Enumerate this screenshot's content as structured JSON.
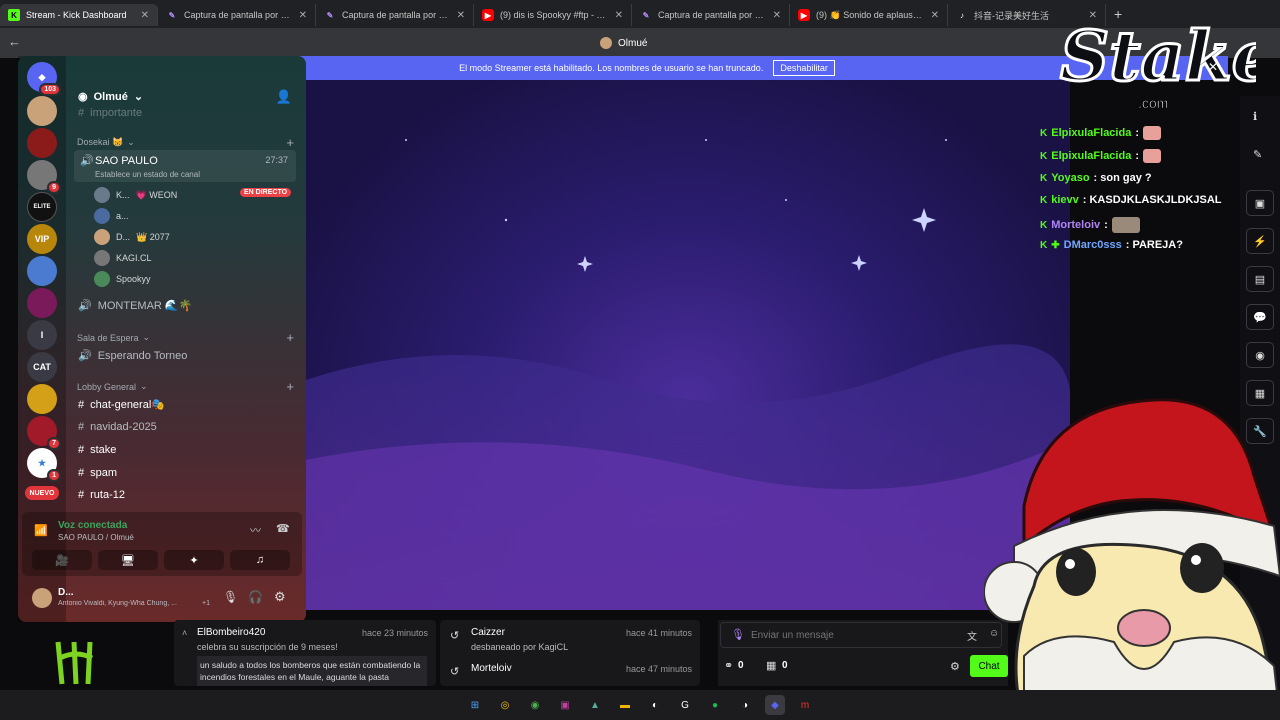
{
  "browser": {
    "tabs": [
      {
        "title": "Stream - Kick Dashboard",
        "icon": "kick-icon",
        "active": true
      },
      {
        "title": "Captura de pantalla por Lightsh",
        "icon": "lightshot-icon"
      },
      {
        "title": "Captura de pantalla por Lightsh",
        "icon": "lightshot-icon"
      },
      {
        "title": "(9) dis is Spookyy #ftp - YouTub",
        "icon": "youtube-icon"
      },
      {
        "title": "Captura de pantalla por Lightsh",
        "icon": "lightshot-icon"
      },
      {
        "title": "(9) 👏 Sonido de aplausos y gr",
        "icon": "youtube-icon"
      },
      {
        "title": "抖音-记录美好生活",
        "icon": "tiktok-icon"
      }
    ]
  },
  "discord": {
    "window_title": "Olmué",
    "server_name": "Olmué",
    "streamer_banner": {
      "text": "El modo Streamer está habilitado. Los nombres de usuario se han truncado.",
      "button": "Deshabilitar"
    },
    "guild_badges": {
      "top": "103",
      "g4": "9",
      "g13": "7",
      "g14": "1",
      "new": "NUEVO"
    },
    "guild_labels": {
      "elite": "ELITE",
      "vip": "VIP",
      "i": "I",
      "cat": "CAT"
    },
    "channels": {
      "faded": "importante",
      "cat1": "Dosekai 😸",
      "voice1": {
        "name": "SAO PAULO",
        "status": "Establece un estado de canal",
        "time": "27:37"
      },
      "members": [
        {
          "name": "K...",
          "extra": "💗 WEON",
          "live": "EN DIRECTO"
        },
        {
          "name": "a..."
        },
        {
          "name": "D...",
          "extra": "👑 2077"
        },
        {
          "name": "KAGI.CL"
        },
        {
          "name": "Spookyy"
        }
      ],
      "voice2": "MONTEMAR 🌊🌴",
      "cat2": "Sala de Espera",
      "voice3": "Esperando Torneo",
      "cat3": "Lobby General",
      "text": [
        "chat-general🎭",
        "navidad-2025",
        "stake",
        "spam",
        "ruta-12"
      ]
    },
    "voice": {
      "status": "Voz conectada",
      "location": "SAO PAULO / Olmué"
    },
    "user": {
      "name": "D...",
      "activity": "Antonio Vivaldi, Kyung-Wha Chung, ...",
      "more": "+1"
    }
  },
  "chat_overlay": [
    {
      "user": "ElpixulaFlacida",
      "text": ":",
      "color": "#53fc18",
      "emote": true
    },
    {
      "user": "ElpixulaFlacida",
      "text": ":",
      "color": "#53fc18",
      "emote": true
    },
    {
      "user": "Yoyaso",
      "text": ": son gay ?",
      "color": "#53fc18"
    },
    {
      "user": "kievv",
      "text": ": KASDJKLASKJLDKJSAL",
      "color": "#53fc18"
    },
    {
      "user": "Morteloiv",
      "text": ":",
      "color": "#b084f5",
      "emote": true
    },
    {
      "user": "DMarc0sss",
      "text": ": PAREJA?",
      "color": "#6fa8ff"
    }
  ],
  "activity": {
    "user": "ElBombeiro420",
    "time": "hace 23 minutos",
    "line": "celebra su suscripción de 9 meses!",
    "message": "un saludo a todos los bomberos que están combatiendo la incendios forestales en el Maule, aguante la pasta"
  },
  "mod_log": [
    {
      "user": "Caizzer",
      "time": "hace 41 minutos",
      "action": "desbaneado por KagiCL"
    },
    {
      "user": "Morteloiv",
      "time": "hace 47 minutos",
      "action": ""
    }
  ],
  "chat": {
    "placeholder": "Enviar un mensaje",
    "count1": "0",
    "count2": "0",
    "send": "Chat"
  },
  "overlay_logo": {
    "brand": "Stake",
    "suffix": ".com"
  },
  "colors": {
    "kick_green": "#53fc18",
    "blurple": "#5865f2",
    "live_red": "#ed4245"
  }
}
